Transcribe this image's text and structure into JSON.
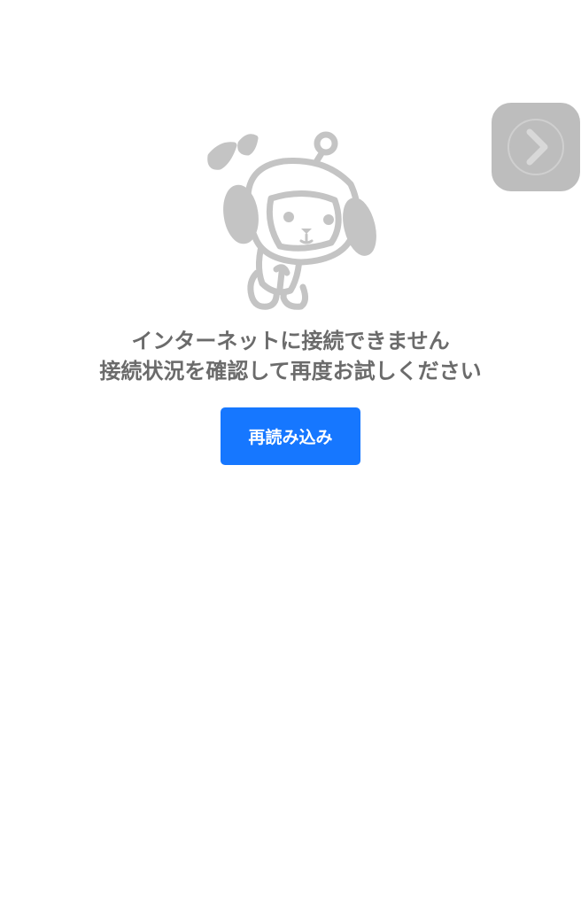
{
  "error": {
    "message_line1": "インターネットに接続できません",
    "message_line2": "接続状況を確認して再度お試しください"
  },
  "actions": {
    "reload_label": "再読み込み"
  },
  "icons": {
    "mascot": "offline-mascot-icon",
    "next": "chevron-right-icon"
  },
  "colors": {
    "accent": "#1677ff",
    "message_text": "#6b6b6b",
    "next_button_bg": "#bdbdbd",
    "mascot_stroke": "#c4c4c4",
    "background": "#ffffff"
  }
}
